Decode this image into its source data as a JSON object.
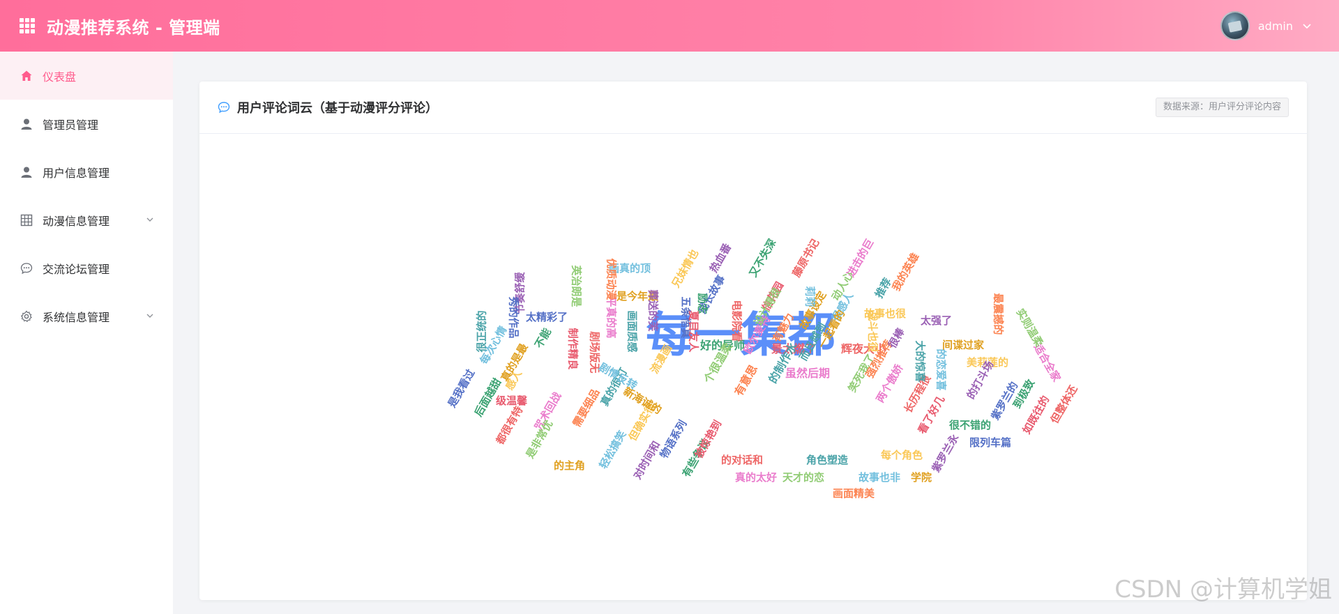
{
  "header": {
    "title": "动漫推荐系统 - 管理端",
    "user_name": "admin",
    "icons": {
      "logo": "grid-icon",
      "dropdown": "chevron-down-icon"
    }
  },
  "sidebar": {
    "items": [
      {
        "label": "仪表盘",
        "icon": "home-icon",
        "active": true
      },
      {
        "label": "管理员管理",
        "icon": "user-icon"
      },
      {
        "label": "用户信息管理",
        "icon": "user-icon"
      },
      {
        "label": "动漫信息管理",
        "icon": "grid-table-icon",
        "has_children": true
      },
      {
        "label": "交流论坛管理",
        "icon": "chat-icon"
      },
      {
        "label": "系统信息管理",
        "icon": "gear-icon",
        "has_children": true
      }
    ]
  },
  "card": {
    "title": "用户评论词云（基于动漫评分评论）",
    "source": "数据来源：用户评分评论内容",
    "icon": "comment-icon"
  },
  "colors": {
    "header_start": "#ff6e9b",
    "header_end": "#ffabc4",
    "accent": "#ff5c8d",
    "active_bg": "#fdf0f4"
  },
  "word_cloud": {
    "words": [
      "每一集都",
      "好的导师",
      "景太燃了",
      "辉夜大小",
      "虽然后期",
      "个很温柔",
      "有意思",
      "的制作水",
      "画真的顶",
      "是今年最",
      "兄妹情也",
      "热血番",
      "成长故事",
      "又不失深",
      "信花园",
      "藤原书记",
      "进击的巨",
      "动人心",
      "我的英雄",
      "推荐",
      "很感人",
      "故事设定",
      "故事也很",
      "太强了",
      "是我看过",
      "后面越甜",
      "级温馨",
      "都很有特",
      "咒术回战",
      "是非常优",
      "需要细品",
      "真的很打",
      "轻松搞笑",
      "的主角",
      "但确实很",
      "对时间和",
      "物语系列",
      "有些争议",
      "被惊艳到",
      "的对话和",
      "真的太好",
      "天才的恋",
      "画面精美",
      "角色塑造",
      "故事也非",
      "学院",
      "每个角色",
      "紫罗兰永",
      "限列车篇",
      "很不错的",
      "看了好几",
      "长历程很",
      "两个傲娇",
      "笑死我了",
      "强烈推荐",
      "大的惊喜",
      "的恋爱喜",
      "间谍过家",
      "美莉莲的",
      "的打斗场",
      "紫罗兰的",
      "到极致",
      "如既往的",
      "但整体还",
      "适合全家",
      "实则温柔",
      "最震撼的",
      "很正统的",
      "每次心情",
      "真的是最",
      "感人",
      "节奏舒缓",
      "太精彩了",
      "不能",
      "制作精良",
      "剧场版无",
      "平真的高",
      "英治朗是",
      "优质动漫",
      "画面质感",
      "剧情反转",
      "新海诚的",
      "流漫画",
      "葬送的芙",
      "五条悟真",
      "励志",
      "夏目友人",
      "电影院看",
      "欧尔麦特",
      "设计得很",
      "有魅力",
      "而且越到",
      "莉莉",
      "一起看的",
      "战斗也很",
      "很棒",
      "秀的作品"
    ]
  }
}
